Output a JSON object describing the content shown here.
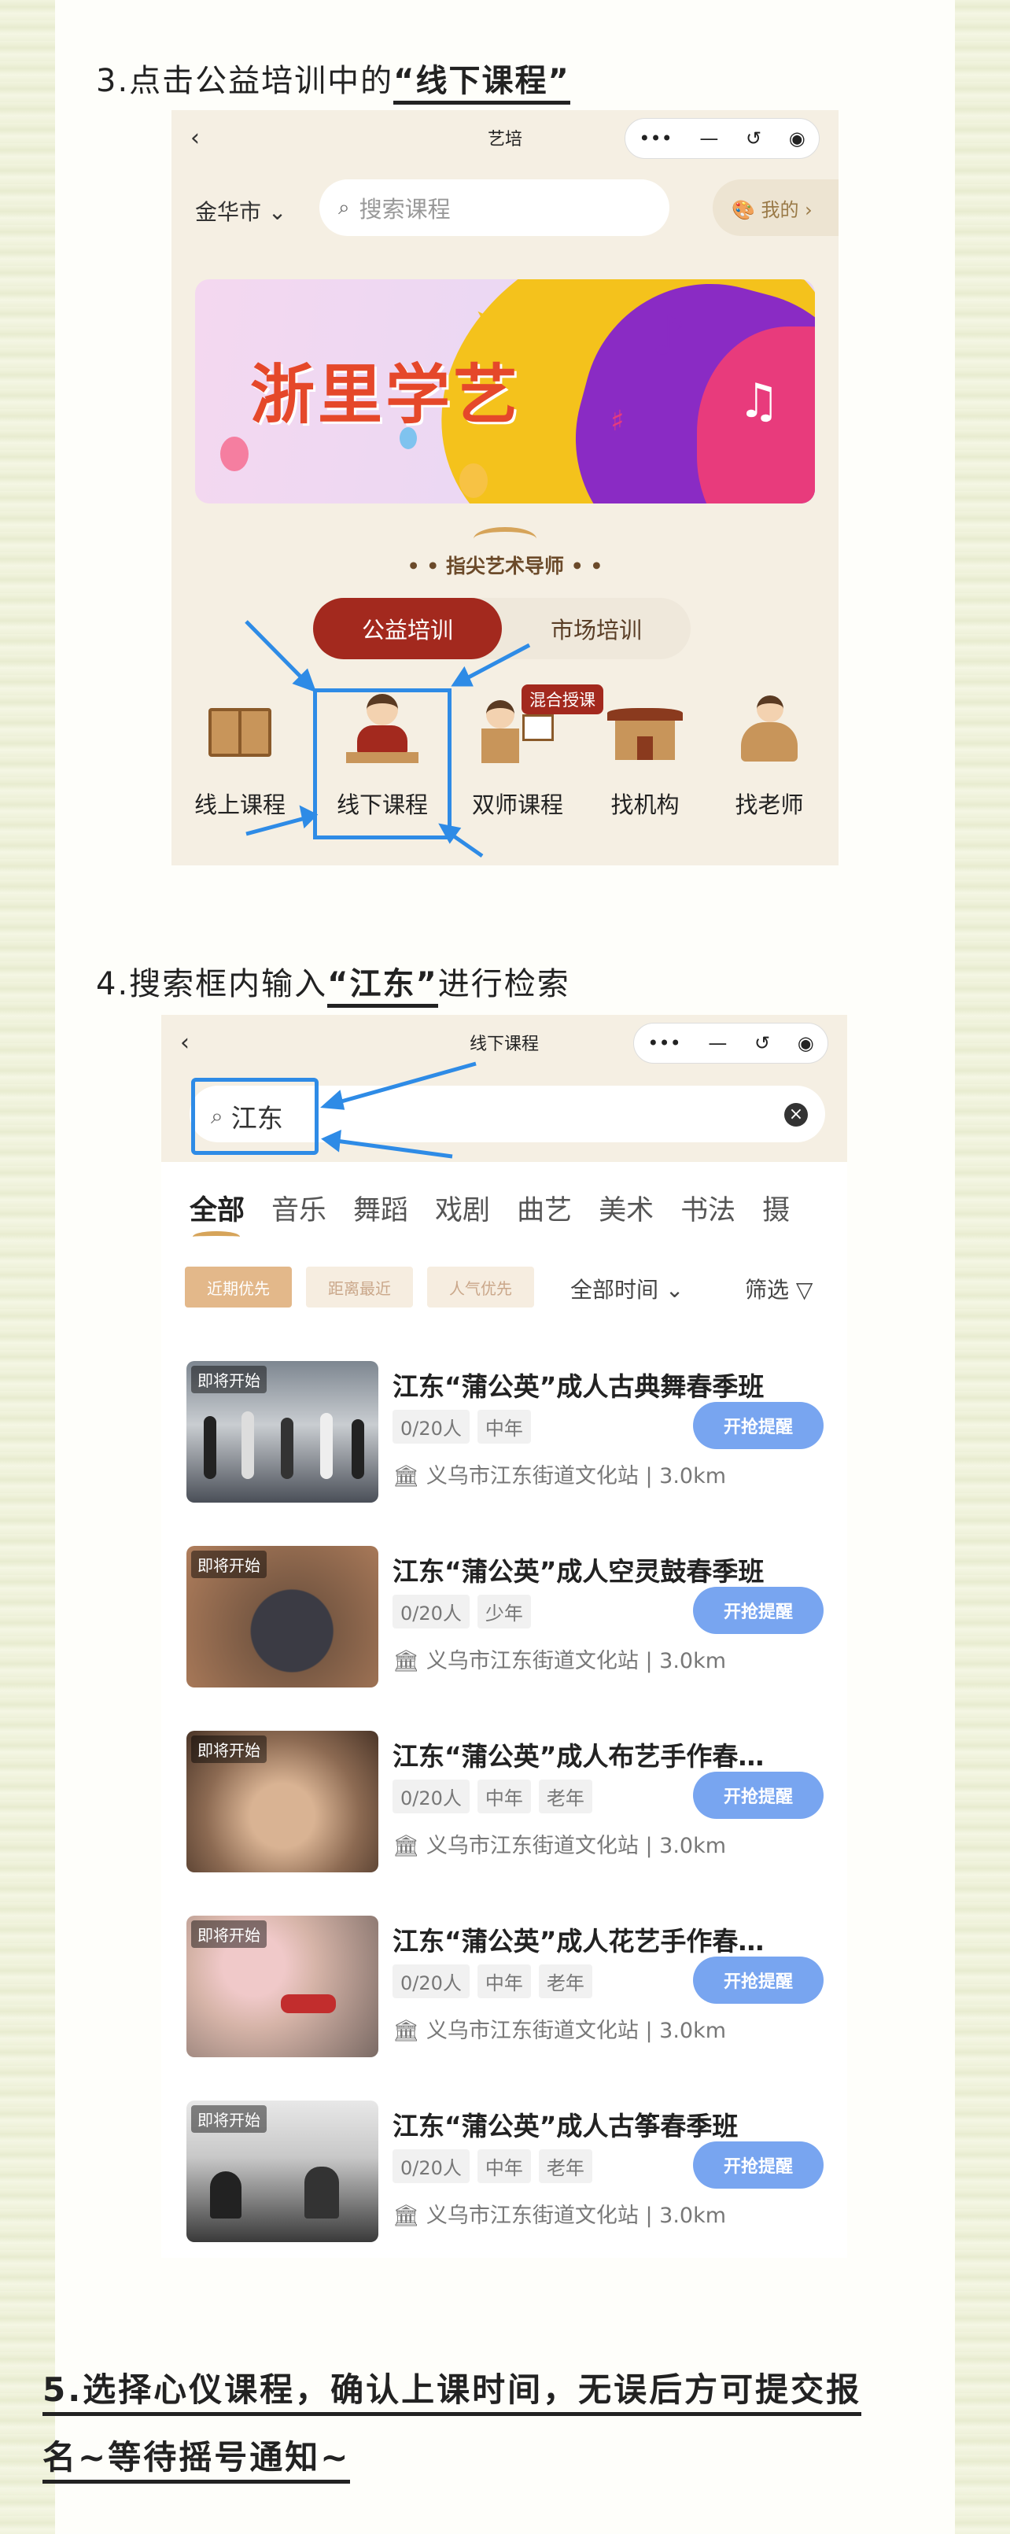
{
  "step3": {
    "prefix": "3.点击公益培训中的",
    "highlight": "“线下课程”"
  },
  "screen1": {
    "title": "艺培",
    "back": "‹",
    "capsule": [
      "•••",
      "—",
      "↺",
      "◉"
    ],
    "city": "金华市 ⌄",
    "search_placeholder": "搜索课程",
    "mine": "🎨 我的 ›",
    "banner_title": "浙里学艺",
    "mentor_label": "• • 指尖艺术导师 • •",
    "tabs": [
      "公益培训",
      "市场培训"
    ],
    "categories": [
      "线上课程",
      "线下课程",
      "双师课程",
      "找机构",
      "找老师"
    ],
    "mix_tag": "混合授课"
  },
  "step4": {
    "prefix": "4.搜索框内输入",
    "highlight": "“江东”",
    "suffix": "进行检索"
  },
  "screen2": {
    "title": "线下课程",
    "back": "‹",
    "capsule": [
      "•••",
      "—",
      "↺",
      "◉"
    ],
    "search_value": "江东",
    "clear": "×",
    "category_tabs": [
      "全部",
      "音乐",
      "舞蹈",
      "戏剧",
      "曲艺",
      "美术",
      "书法",
      "摄"
    ],
    "filters": [
      "近期优先",
      "距离最近",
      "人气优先"
    ],
    "time_filter": "全部时间 ⌄",
    "screen_filter": "筛选 ▽",
    "courses": [
      {
        "status": "即将开始",
        "title": "江东“蒲公英”成人古典舞春季班",
        "count": "0/20人",
        "tags": [
          "中年"
        ],
        "button": "开抢提醒",
        "location": "义乌市江东街道文化站 | 3.0km"
      },
      {
        "status": "即将开始",
        "title": "江东“蒲公英”成人空灵鼓春季班",
        "count": "0/20人",
        "tags": [
          "少年"
        ],
        "button": "开抢提醒",
        "location": "义乌市江东街道文化站 | 3.0km"
      },
      {
        "status": "即将开始",
        "title": "江东“蒲公英”成人布艺手作春…",
        "count": "0/20人",
        "tags": [
          "中年",
          "老年"
        ],
        "button": "开抢提醒",
        "location": "义乌市江东街道文化站 | 3.0km"
      },
      {
        "status": "即将开始",
        "title": "江东“蒲公英”成人花艺手作春…",
        "count": "0/20人",
        "tags": [
          "中年",
          "老年"
        ],
        "button": "开抢提醒",
        "location": "义乌市江东街道文化站 | 3.0km"
      },
      {
        "status": "即将开始",
        "title": "江东“蒲公英”成人古筝春季班",
        "count": "0/20人",
        "tags": [
          "中年",
          "老年"
        ],
        "button": "开抢提醒",
        "location": "义乌市江东街道文化站 | 3.0km"
      }
    ]
  },
  "step5": "5.选择心仪课程，确认上课时间，无误后方可提交报名~等待摇号通知~",
  "colors": {
    "accent": "#a3291e",
    "highlight_blue": "#2e8be6",
    "remind_button": "#78a5f0"
  }
}
